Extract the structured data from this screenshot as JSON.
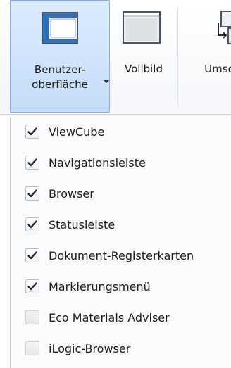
{
  "ribbon": {
    "buttons": [
      {
        "label_line1": "Benutzer-",
        "label_line2": "oberfläche",
        "icon": "user-interface-window-icon",
        "has_dropdown": true
      },
      {
        "label": "Vollbild",
        "icon": "full-screen-window-icon"
      },
      {
        "label": "Umsc",
        "icon": "switch-window-icon"
      }
    ]
  },
  "menu": {
    "items": [
      {
        "label": "ViewCube",
        "checked": true
      },
      {
        "label": "Navigationsleiste",
        "checked": true
      },
      {
        "label": "Browser",
        "checked": true
      },
      {
        "label": "Statusleiste",
        "checked": true
      },
      {
        "label": "Dokument-Registerkarten",
        "checked": true
      },
      {
        "label": "Markierungsmenü",
        "checked": true
      },
      {
        "label": "Eco Materials Adviser",
        "checked": false
      },
      {
        "label": "iLogic-Browser",
        "checked": false
      }
    ]
  },
  "colors": {
    "selected_button_bg": "#c8def6",
    "selected_button_border": "#83aedf",
    "checkmark": "#1f2a3a"
  }
}
